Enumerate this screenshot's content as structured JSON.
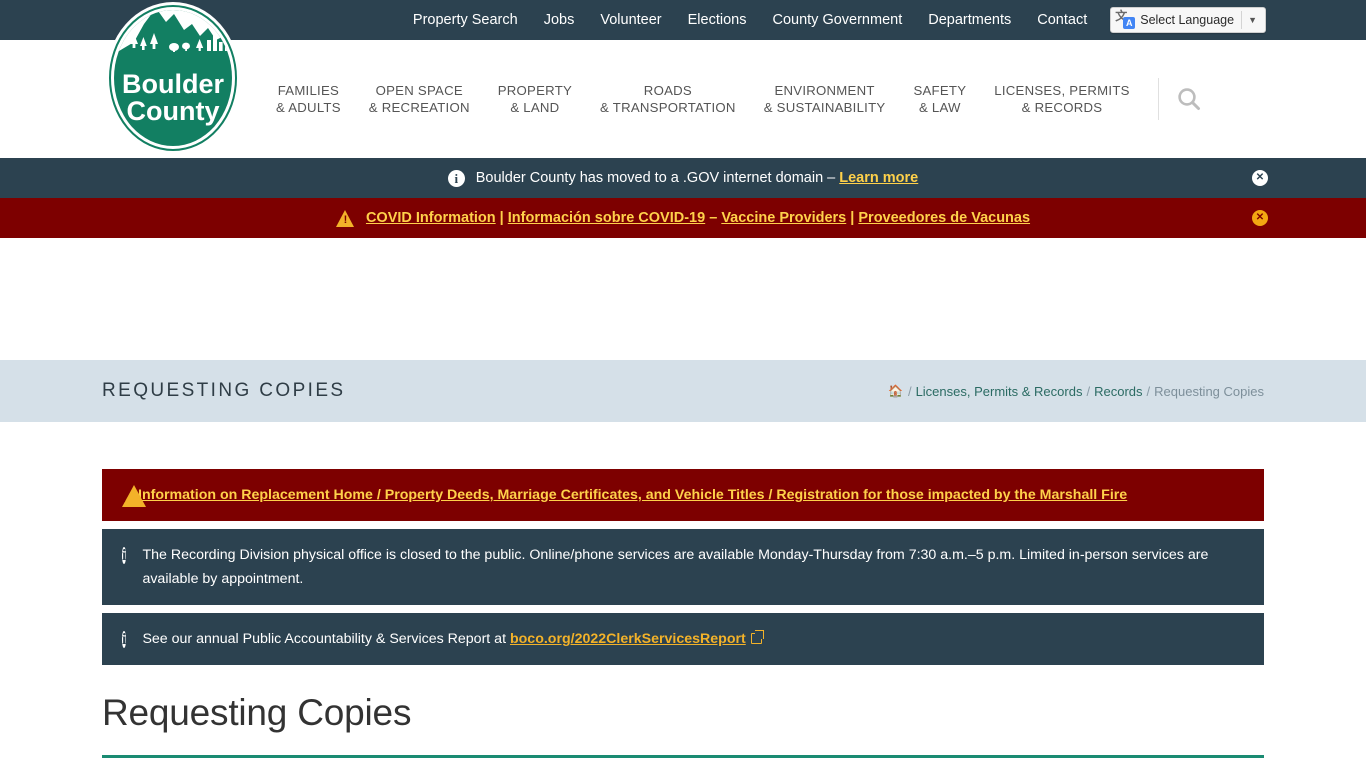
{
  "topbar": {
    "links": [
      {
        "label": "Property Search",
        "name": "topbar-link-property-search"
      },
      {
        "label": "Jobs",
        "name": "topbar-link-jobs"
      },
      {
        "label": "Volunteer",
        "name": "topbar-link-volunteer"
      },
      {
        "label": "Elections",
        "name": "topbar-link-elections"
      },
      {
        "label": "County Government",
        "name": "topbar-link-county-government"
      },
      {
        "label": "Departments",
        "name": "topbar-link-departments"
      },
      {
        "label": "Contact",
        "name": "topbar-link-contact"
      }
    ],
    "language_widget": {
      "label": "Select Language",
      "caret": "▼",
      "icon_glyph_a": "文",
      "icon_glyph_b": "A"
    }
  },
  "logo": {
    "line1": "Boulder",
    "line2": "County",
    "alt": "Boulder County"
  },
  "mainnav": {
    "items": [
      {
        "line1": "FAMILIES",
        "line2": "& ADULTS",
        "name": "nav-families-adults"
      },
      {
        "line1": "OPEN SPACE",
        "line2": "& RECREATION",
        "name": "nav-open-space-recreation"
      },
      {
        "line1": "PROPERTY",
        "line2": "& LAND",
        "name": "nav-property-land"
      },
      {
        "line1": "ROADS",
        "line2": "& TRANSPORTATION",
        "name": "nav-roads-transportation"
      },
      {
        "line1": "ENVIRONMENT",
        "line2": "& SUSTAINABILITY",
        "name": "nav-environment-sustainability"
      },
      {
        "line1": "SAFETY",
        "line2": "& LAW",
        "name": "nav-safety-law"
      },
      {
        "line1": "LICENSES, PERMITS",
        "line2": "& RECORDS",
        "name": "nav-licenses-permits-records"
      }
    ],
    "search_icon": "search-icon"
  },
  "site_banners": [
    {
      "type": "info",
      "icon": "info-circle-icon",
      "text_before": "Boulder County has moved to a .GOV internet domain – ",
      "link": "Learn more",
      "close_label": "✕"
    },
    {
      "type": "alert",
      "icon": "warning-triangle-icon",
      "links": [
        "COVID Information",
        "Información sobre COVID-19",
        "Vaccine Providers",
        "Proveedores de Vacunas"
      ],
      "separators": [
        " | ",
        " – ",
        " | "
      ],
      "close_label": "✕"
    }
  ],
  "title_band": {
    "page_title": "REQUESTING COPIES",
    "breadcrumb": {
      "home_icon": "home-icon",
      "items": [
        {
          "label": "Licenses, Permits & Records",
          "current": false
        },
        {
          "label": "Records",
          "current": false
        },
        {
          "label": "Requesting Copies",
          "current": true
        }
      ],
      "separator": "/"
    }
  },
  "content": {
    "alerts": [
      {
        "type": "red",
        "icon": "warning-triangle-icon",
        "link_text": "Information on Replacement Home / Property Deeds, Marriage Certificates, and Vehicle Titles / Registration for those impacted by the Marshall Fire"
      },
      {
        "type": "dark",
        "icon": "info-circle-icon",
        "text": "The Recording Division physical office is closed to the public. Online/phone services are available Monday-Thursday from 7:30 a.m.–5 p.m. Limited in-person services are available by appointment."
      },
      {
        "type": "dark",
        "icon": "info-circle-icon",
        "text_before": "See our annual Public Accountability & Services Report at ",
        "link": "boco.org/2022ClerkServicesReport",
        "external_icon": "external-link-icon"
      }
    ],
    "heading": "Requesting Copies"
  },
  "colors": {
    "navy": "#2c4250",
    "dark_red": "#7d0000",
    "amber": "#ffd14a",
    "teal": "#1a8b72",
    "band_blue": "#d5e0e8",
    "logo_green": "#127f62"
  }
}
